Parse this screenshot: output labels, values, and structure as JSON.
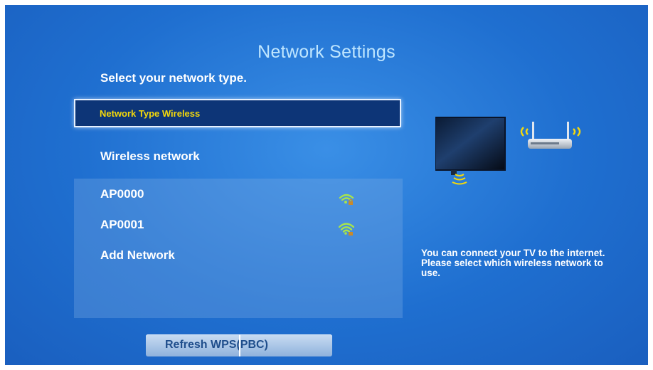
{
  "screen": {
    "title": "Network Settings",
    "subtitle": "Select your network type.",
    "network_type_label": "Network Type Wireless",
    "wireless_label": "Wireless network",
    "networks": [
      {
        "name": "AP0000",
        "icon": "wifi-locked-icon",
        "signal": "medium"
      },
      {
        "name": "AP0001",
        "icon": "wifi-locked-icon",
        "signal": "strong"
      },
      {
        "name": "Add Network"
      }
    ],
    "info_text": "You can connect your TV to the internet. Please select which wireless network to use.",
    "buttons": {
      "refresh_label": "Refresh",
      "wps_label": "WPS(PBC)"
    },
    "colors": {
      "background": "#1f6fd0",
      "selected_bg": "#0d3577",
      "selected_text": "#f5d90a",
      "title": "#bfe6ff",
      "wifi_icon": "#a6e34d"
    }
  }
}
